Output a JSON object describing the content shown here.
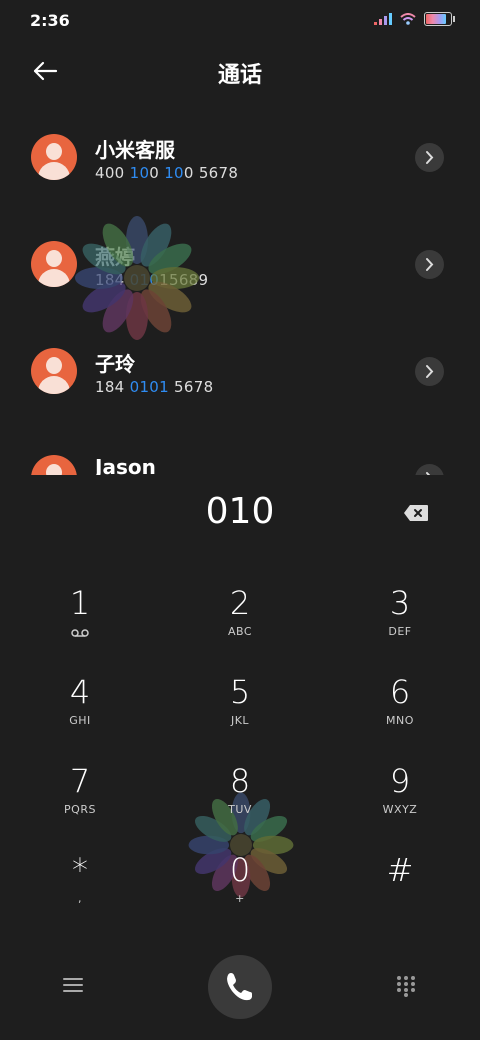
{
  "status_bar": {
    "time": "2:36",
    "icons": [
      "signal-icon",
      "wifi-icon",
      "battery-icon"
    ],
    "battery_level": 0.9
  },
  "header": {
    "title": "通话",
    "back_icon": "arrow-left-icon"
  },
  "contacts": [
    {
      "name": "小米客服",
      "number_parts": [
        "400 ",
        "10",
        "0 ",
        "10",
        "0 5678"
      ]
    },
    {
      "name": "燕婷",
      "number_parts": [
        "184 ",
        "010",
        "15689"
      ]
    },
    {
      "name": "子玲",
      "number_parts": [
        "184 ",
        "0101",
        " 5678"
      ]
    },
    {
      "name": "Jason"
    }
  ],
  "dialer": {
    "number": "010",
    "keys": [
      {
        "digit": "1",
        "letters": ""
      },
      {
        "digit": "2",
        "letters": "ABC"
      },
      {
        "digit": "3",
        "letters": "DEF"
      },
      {
        "digit": "4",
        "letters": "GHI"
      },
      {
        "digit": "5",
        "letters": "JKL"
      },
      {
        "digit": "6",
        "letters": "MNO"
      },
      {
        "digit": "7",
        "letters": "PQRS"
      },
      {
        "digit": "8",
        "letters": "TUV"
      },
      {
        "digit": "9",
        "letters": "WXYZ"
      },
      {
        "digit": "*",
        "letters": ","
      },
      {
        "digit": "0",
        "letters": "+"
      },
      {
        "digit": "#",
        "letters": ""
      }
    ]
  },
  "colors": {
    "background": "#1e1e1e",
    "avatar": "#e8653f",
    "highlight": "#2f8cf2"
  }
}
